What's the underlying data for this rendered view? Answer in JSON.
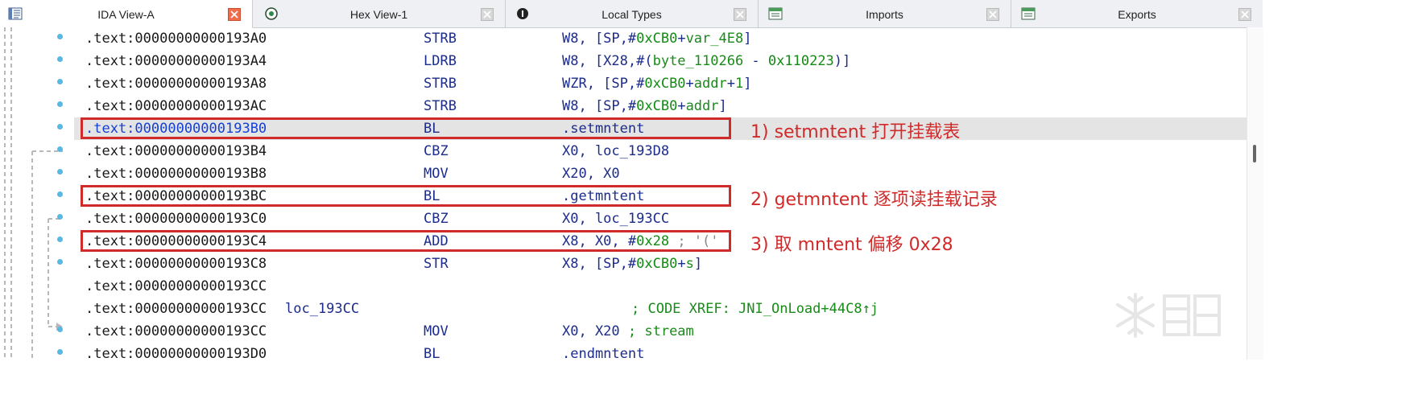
{
  "tabs": [
    {
      "label": "IDA View-A",
      "active": true,
      "icon": "listing-icon"
    },
    {
      "label": "Hex View-1",
      "active": false,
      "icon": "hex-icon"
    },
    {
      "label": "Local Types",
      "active": false,
      "icon": "types-icon"
    },
    {
      "label": "Imports",
      "active": false,
      "icon": "imports-icon"
    },
    {
      "label": "Exports",
      "active": false,
      "icon": "exports-icon"
    }
  ],
  "rows": [
    {
      "addr": ".text:00000000000193A0",
      "label": "",
      "mnem": "STRB",
      "ops": [
        [
          "t",
          "W8, [SP,#"
        ],
        [
          "n",
          "0xCB0"
        ],
        [
          "t",
          "+"
        ],
        [
          "s",
          "var_4E8"
        ],
        [
          "t",
          "]"
        ]
      ]
    },
    {
      "addr": ".text:00000000000193A4",
      "label": "",
      "mnem": "LDRB",
      "ops": [
        [
          "t",
          "W8, [X28,#("
        ],
        [
          "s",
          "byte_110266"
        ],
        [
          "t",
          " - "
        ],
        [
          "n",
          "0x110223"
        ],
        [
          "t",
          ")]"
        ]
      ]
    },
    {
      "addr": ".text:00000000000193A8",
      "label": "",
      "mnem": "STRB",
      "ops": [
        [
          "t",
          "WZR, [SP,#"
        ],
        [
          "n",
          "0xCB0"
        ],
        [
          "t",
          "+"
        ],
        [
          "s",
          "addr"
        ],
        [
          "t",
          "+"
        ],
        [
          "n",
          "1"
        ],
        [
          "t",
          "]"
        ]
      ]
    },
    {
      "addr": ".text:00000000000193AC",
      "label": "",
      "mnem": "STRB",
      "ops": [
        [
          "t",
          "W8, [SP,#"
        ],
        [
          "n",
          "0xCB0"
        ],
        [
          "t",
          "+"
        ],
        [
          "s",
          "addr"
        ],
        [
          "t",
          "]"
        ]
      ]
    },
    {
      "addr": ".text:00000000000193B0",
      "label": "",
      "mnem": "BL",
      "highlight": true,
      "ops": [
        [
          "t",
          ".setmntent"
        ]
      ]
    },
    {
      "addr": ".text:00000000000193B4",
      "label": "",
      "mnem": "CBZ",
      "ops": [
        [
          "t",
          "X0, loc_193D8"
        ]
      ]
    },
    {
      "addr": ".text:00000000000193B8",
      "label": "",
      "mnem": "MOV",
      "ops": [
        [
          "t",
          "X20, X0"
        ]
      ]
    },
    {
      "addr": ".text:00000000000193BC",
      "label": "",
      "mnem": "BL",
      "ops": [
        [
          "t",
          ".getmntent"
        ]
      ]
    },
    {
      "addr": ".text:00000000000193C0",
      "label": "",
      "mnem": "CBZ",
      "ops": [
        [
          "t",
          "X0, loc_193CC"
        ]
      ]
    },
    {
      "addr": ".text:00000000000193C4",
      "label": "",
      "mnem": "ADD",
      "ops": [
        [
          "t",
          "X8, X0, #"
        ],
        [
          "n",
          "0x28"
        ],
        [
          "g",
          " ; '('"
        ]
      ]
    },
    {
      "addr": ".text:00000000000193C8",
      "label": "",
      "mnem": "STR",
      "ops": [
        [
          "t",
          "X8, [SP,#"
        ],
        [
          "n",
          "0xCB0"
        ],
        [
          "t",
          "+"
        ],
        [
          "s",
          "s"
        ],
        [
          "t",
          "]"
        ]
      ]
    },
    {
      "addr": ".text:00000000000193CC",
      "label": "",
      "mnem": "",
      "ops": []
    },
    {
      "addr": ".text:00000000000193CC",
      "label": "loc_193CC",
      "mnem": "",
      "ops": [],
      "comment": "; CODE XREF: JNI_OnLoad+44C8↑j"
    },
    {
      "addr": ".text:00000000000193CC",
      "label": "",
      "mnem": "MOV",
      "ops": [
        [
          "t",
          "X0, X20 "
        ],
        [
          "s",
          "; stream"
        ]
      ]
    },
    {
      "addr": ".text:00000000000193D0",
      "label": "",
      "mnem": "BL",
      "ops": [
        [
          "t",
          ".endmntent"
        ]
      ]
    }
  ],
  "annotations": [
    {
      "row": 4,
      "text": "1) setmntent 打开挂载表"
    },
    {
      "row": 7,
      "text": "2) getmntent 逐项读挂载记录"
    },
    {
      "row": 9,
      "text": "3) 取 mntent 偏移 0x28"
    }
  ],
  "colors": {
    "annotation": "#d12a2a",
    "mnemonic": "#1c2c8a",
    "number": "#138a13",
    "highlight": "#e4e4e4"
  }
}
